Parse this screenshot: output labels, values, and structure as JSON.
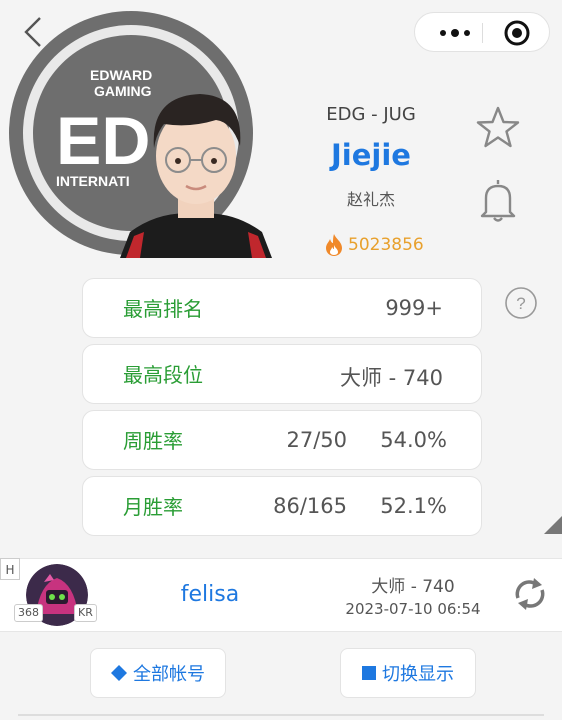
{
  "nav": {
    "back_icon": "chevron-left-icon",
    "more_icon": "more-dots-icon",
    "target_icon": "target-icon"
  },
  "logo": {
    "lines": [
      "EDWARD",
      "GAMING",
      "ED",
      "INTERNATI"
    ],
    "colors": {
      "ring": "#6e6e6e",
      "inner": "#e9e9e9"
    }
  },
  "player": {
    "team_role": "EDG - JUG",
    "id": "Jiejie",
    "real_name": "赵礼杰",
    "heat_score": "5023856"
  },
  "actions": {
    "favorite_icon": "star-icon",
    "notify_icon": "bell-icon",
    "help_icon": "question-icon",
    "help_text": "?"
  },
  "stats": [
    {
      "label": "最高排名",
      "value": "999+"
    },
    {
      "label": "最高段位",
      "value": "大师 - 740"
    },
    {
      "label": "周胜率",
      "record": "27/50",
      "rate": "54.0%"
    },
    {
      "label": "月胜率",
      "record": "86/165",
      "rate": "52.1%"
    }
  ],
  "account": {
    "badge": "H",
    "level": "368",
    "region": "KR",
    "name": "felisa",
    "rank": "大师 - 740",
    "updated": "2023-07-10 06:54",
    "refresh_icon": "refresh-icon"
  },
  "buttons": {
    "all_accounts": "全部帐号",
    "switch_display": "切换显示"
  },
  "colors": {
    "accent_blue": "#1e78e0",
    "label_green": "#2a9d35",
    "heat_orange": "#e8a02c"
  }
}
